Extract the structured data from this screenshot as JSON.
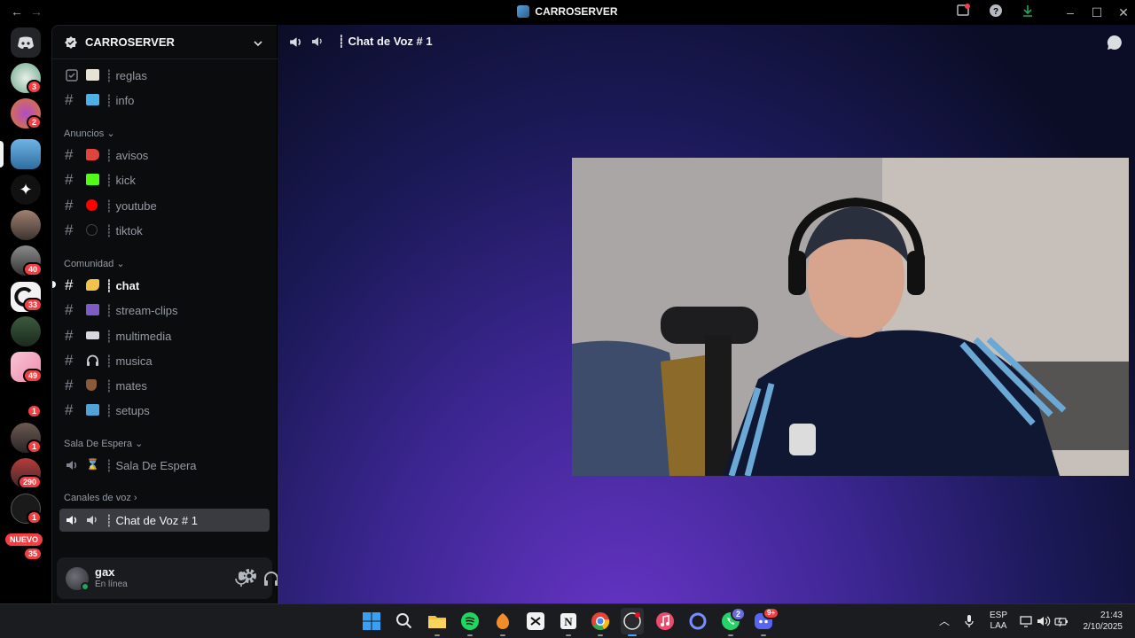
{
  "window": {
    "title": "CARROSERVER"
  },
  "rail": {
    "new_label": "NUEVO",
    "badges": [
      "3",
      "2",
      "40",
      "33",
      "49",
      "1",
      "1",
      "290",
      "1",
      "35"
    ]
  },
  "sidebar": {
    "server_name": "CARROSERVER",
    "channels_top": [
      {
        "label": "reglas"
      },
      {
        "label": "info"
      }
    ],
    "categories": {
      "anuncios": "Anuncios",
      "comunidad": "Comunidad",
      "sala": "Sala De Espera",
      "voz": "Canales de voz"
    },
    "anuncios": [
      {
        "label": "avisos"
      },
      {
        "label": "kick"
      },
      {
        "label": "youtube"
      },
      {
        "label": "tiktok"
      }
    ],
    "comunidad": [
      {
        "label": "chat"
      },
      {
        "label": "stream-clips"
      },
      {
        "label": "multimedia"
      },
      {
        "label": "musica"
      },
      {
        "label": "mates"
      },
      {
        "label": "setups"
      }
    ],
    "sala": [
      {
        "label": "Sala De Espera"
      }
    ],
    "voz": [
      {
        "label": "Chat de Voz # 1"
      }
    ],
    "separator": "┊"
  },
  "user": {
    "name": "gax",
    "status": "En línea"
  },
  "stage": {
    "title": "Chat de Voz # 1"
  },
  "taskbar": {
    "lang_top": "ESP",
    "lang_bottom": "LAA",
    "time": "21:43",
    "date": "2/10/2025",
    "whatsapp_badge": "2",
    "discord_badge": "9+"
  }
}
